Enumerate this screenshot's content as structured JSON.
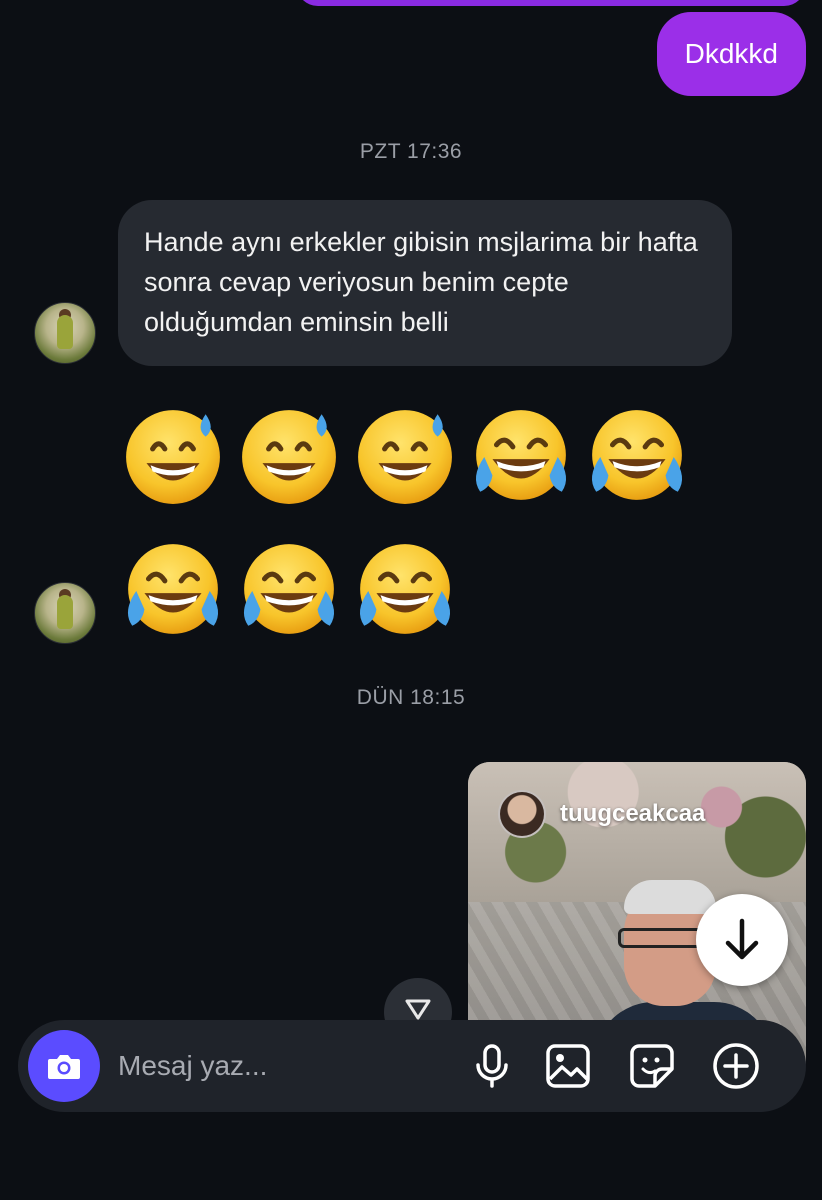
{
  "conversation": {
    "outgoing_messages": [
      {
        "text": "Dkdkkd"
      }
    ],
    "timestamps": [
      {
        "label": "PZT 17:36"
      },
      {
        "label": "DÜN 18:15"
      }
    ],
    "incoming_message": {
      "text": "Hande aynı erkekler gibisin msjlarima bir hafta sonra cevap veriyosun benim cepte olduğumdan eminsin belli"
    },
    "emoji_rows": [
      [
        "grinning-face-with-sweat",
        "grinning-face-with-sweat",
        "grinning-face-with-sweat",
        "face-with-tears-of-joy",
        "face-with-tears-of-joy"
      ],
      [
        "face-with-tears-of-joy",
        "face-with-tears-of-joy",
        "face-with-tears-of-joy"
      ]
    ],
    "shared_story": {
      "username": "tuugceakcaa"
    }
  },
  "composer": {
    "placeholder": "Mesaj yaz...",
    "icons": [
      "camera-icon",
      "microphone-icon",
      "gallery-icon",
      "sticker-icon",
      "plus-icon"
    ]
  },
  "colors": {
    "background": "#0c0f14",
    "outgoing_bubble": "#9b2fe8",
    "incoming_bubble": "#262a31",
    "camera_button": "#5b4cff",
    "timestamp_text": "#9a9ea6"
  }
}
